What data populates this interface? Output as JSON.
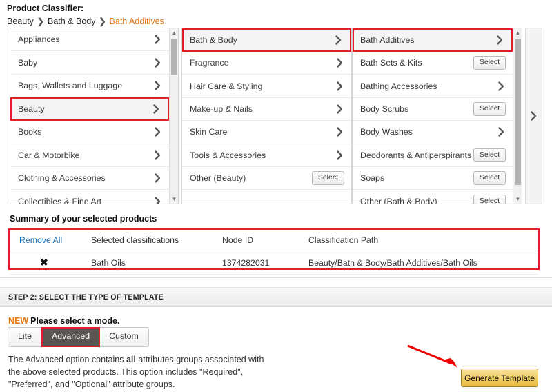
{
  "header": {
    "title": "Product Classifier:",
    "breadcrumb": [
      {
        "label": "Beauty",
        "active": false
      },
      {
        "label": "Bath & Body",
        "active": false
      },
      {
        "label": "Bath Additives",
        "active": true
      }
    ],
    "breadcrumb_separator": "❯"
  },
  "browser": {
    "columns": [
      {
        "name": "root-categories",
        "has_scrollbar": true,
        "rows": [
          {
            "label": "Appliances",
            "control": "chevron",
            "highlighted": false
          },
          {
            "label": "Baby",
            "control": "chevron",
            "highlighted": false
          },
          {
            "label": "Bags, Wallets and Luggage",
            "control": "chevron",
            "highlighted": false
          },
          {
            "label": "Beauty",
            "control": "chevron",
            "highlighted": true
          },
          {
            "label": "Books",
            "control": "chevron",
            "highlighted": false
          },
          {
            "label": "Car & Motorbike",
            "control": "chevron",
            "highlighted": false
          },
          {
            "label": "Clothing & Accessories",
            "control": "chevron",
            "highlighted": false
          },
          {
            "label": "Collectibles & Fine Art",
            "control": "chevron",
            "highlighted": false
          }
        ]
      },
      {
        "name": "beauty-subcategories",
        "has_scrollbar": false,
        "rows": [
          {
            "label": "Bath & Body",
            "control": "chevron",
            "highlighted": true
          },
          {
            "label": "Fragrance",
            "control": "chevron",
            "highlighted": false
          },
          {
            "label": "Hair Care & Styling",
            "control": "chevron",
            "highlighted": false
          },
          {
            "label": "Make-up & Nails",
            "control": "chevron",
            "highlighted": false
          },
          {
            "label": "Skin Care",
            "control": "chevron",
            "highlighted": false
          },
          {
            "label": "Tools & Accessories",
            "control": "chevron",
            "highlighted": false
          },
          {
            "label": "Other (Beauty)",
            "control": "select",
            "highlighted": false
          }
        ]
      },
      {
        "name": "bath-and-body-subcategories",
        "has_scrollbar": true,
        "rows": [
          {
            "label": "Bath Additives",
            "control": "chevron",
            "highlighted": true
          },
          {
            "label": "Bath Sets & Kits",
            "control": "select",
            "highlighted": false
          },
          {
            "label": "Bathing Accessories",
            "control": "chevron",
            "highlighted": false
          },
          {
            "label": "Body Scrubs",
            "control": "select",
            "highlighted": false
          },
          {
            "label": "Body Washes",
            "control": "chevron",
            "highlighted": false
          },
          {
            "label": "Deodorants & Antiperspirants",
            "control": "select",
            "highlighted": false
          },
          {
            "label": "Soaps",
            "control": "select",
            "highlighted": false
          },
          {
            "label": "Other (Bath & Body)",
            "control": "select",
            "highlighted": false
          }
        ]
      }
    ],
    "select_button_label": "Select",
    "next_column_chevron": "chevron-right"
  },
  "summary": {
    "title": "Summary of your selected products",
    "headers": [
      "Remove All",
      "Selected classifications",
      "Node ID",
      "Classification Path"
    ],
    "remove_row_glyph": "✖",
    "rows": [
      {
        "selected_classification": "Bath Oils",
        "node_id": "1374282031",
        "classification_path": "Beauty/Bath & Body/Bath Additives/Bath Oils"
      }
    ]
  },
  "step2": {
    "bar_label": "STEP 2: SELECT THE TYPE OF TEMPLATE",
    "new_tag": "NEW",
    "mode_prompt": "Please select a mode.",
    "modes": [
      {
        "label": "Lite",
        "active": false
      },
      {
        "label": "Advanced",
        "active": true
      },
      {
        "label": "Custom",
        "active": false
      }
    ],
    "blurb_part1": "The Advanced option contains ",
    "blurb_bold": "all",
    "blurb_part2": " attributes groups associated with the above selected products. This option includes \"Required\", \"Preferred\", and \"Optional\" attribute groups.",
    "generate_button_label": "Generate Template"
  },
  "colors": {
    "highlight_red": "#e01f26",
    "accent_orange": "#e47911",
    "link_blue": "#1a6fb5",
    "button_gold": "#e8b93a",
    "active_mode_bg": "#595551"
  }
}
